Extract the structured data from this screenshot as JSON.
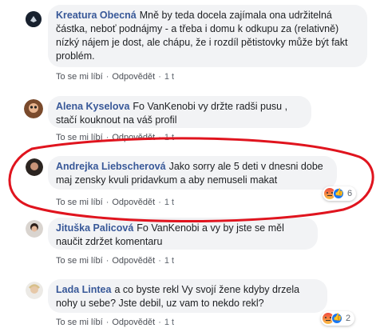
{
  "comments": [
    {
      "author": "Kreatura Obecná",
      "text": "Mně by teda docela zajímala ona udržitelná částka, neboť podnájmy - a třeba i domu k odkupu za (relativně) nízký nájem je dost, ale chápu, že i rozdíl pětistovky může být fakt problém.",
      "like": "To se mi líbí",
      "reply": "Odpovědět",
      "time": "1 t"
    },
    {
      "author": "Alena Kyselova",
      "text": "Fo VanKenobi vy držte radši pusu , stačí kouknout na váš profil",
      "like": "To se mi líbí",
      "reply": "Odpovědět",
      "time": "1 t"
    },
    {
      "author": "Andrejka Liebscherová",
      "text": "Jako sorry ale 5 deti v dnesni dobe maj zensky kvuli pridavkum a aby nemuseli makat",
      "like": "To se mi líbí",
      "reply": "Odpovědět",
      "time": "1 t",
      "reactions_count": "6"
    },
    {
      "author": "Jituška Palicová",
      "text": "Fo VanKenobi a vy by jste se měl naučit zdržet komentaru",
      "like": "To se mi líbí",
      "reply": "Odpovědět",
      "time": "1 t"
    },
    {
      "author": "Lada Lintea",
      "text": "a co byste rekl Vy svojí žene kdyby drzela nohy u sebe? Jste debil, uz vam to nekdo rekl?",
      "like": "To se mi líbí",
      "reply": "Odpovědět",
      "time": "1 t",
      "reactions_count": "2"
    }
  ],
  "colors": {
    "author": "#385898",
    "bubble": "#f2f3f5",
    "highlight_ring": "#e0141e"
  }
}
